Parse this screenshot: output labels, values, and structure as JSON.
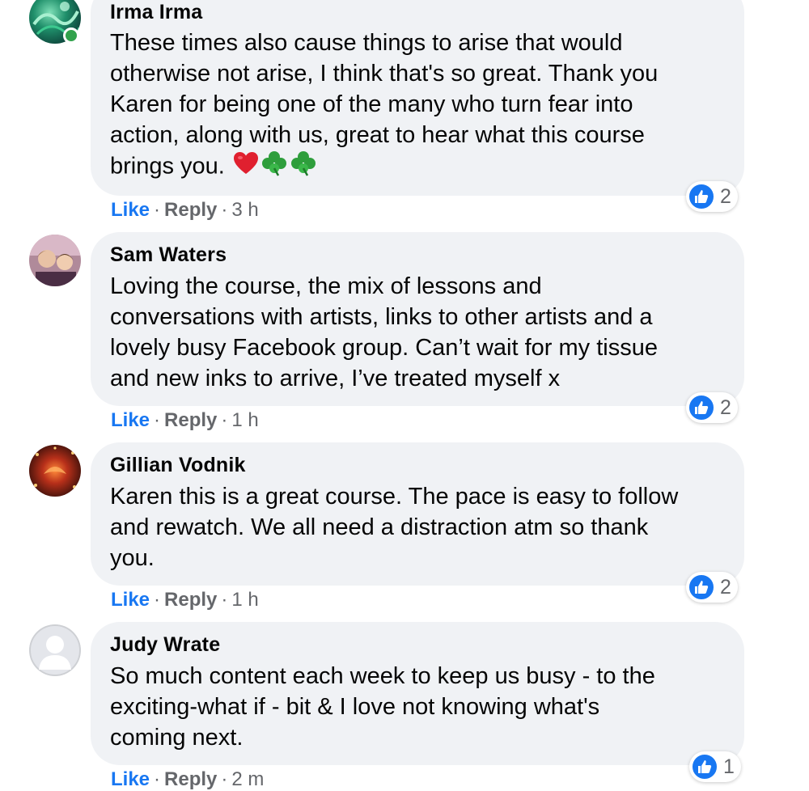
{
  "comments": [
    {
      "author": "Irma Irma",
      "online": true,
      "lines": [
        "These times also cause things to arise that would",
        "otherwise not arise, I think that's so great. Thank you",
        "Karen for being one of the many who turn fear into",
        "action, along with us, great to hear what this course",
        "brings you."
      ],
      "emojis": [
        "red-heart",
        "shamrock",
        "shamrock"
      ],
      "actions": {
        "like": "Like",
        "reply": "Reply",
        "time": "3 h",
        "dot": "·"
      },
      "reaction_count": "2"
    },
    {
      "author": "Sam Waters",
      "online": false,
      "lines": [
        "Loving the course, the mix of lessons and",
        "conversations with artists, links to other artists and a",
        "lovely busy Facebook group. Can’t wait for my tissue",
        "and new inks to arrive, I’ve treated myself x"
      ],
      "actions": {
        "like": "Like",
        "reply": "Reply",
        "time": "1 h",
        "dot": "·"
      },
      "reaction_count": "2"
    },
    {
      "author": "Gillian Vodnik",
      "online": false,
      "lines": [
        "Karen this is a great course. The pace is easy to follow",
        "and rewatch. We all need a distraction atm so thank",
        "you."
      ],
      "actions": {
        "like": "Like",
        "reply": "Reply",
        "time": "1 h",
        "dot": "·"
      },
      "reaction_count": "2"
    },
    {
      "author": "Judy Wrate",
      "online": false,
      "lines": [
        "So much content each week to keep us busy - to the",
        "exciting-what if - bit & I love not knowing what's",
        "coming next."
      ],
      "actions": {
        "like": "Like",
        "reply": "Reply",
        "time": "2 m",
        "dot": "·"
      },
      "reaction_count": "1"
    }
  ],
  "colors": {
    "bubble": "#f0f2f5",
    "like_blue": "#1877f2",
    "meta_gray": "#65676b",
    "online_green": "#31a24c"
  }
}
